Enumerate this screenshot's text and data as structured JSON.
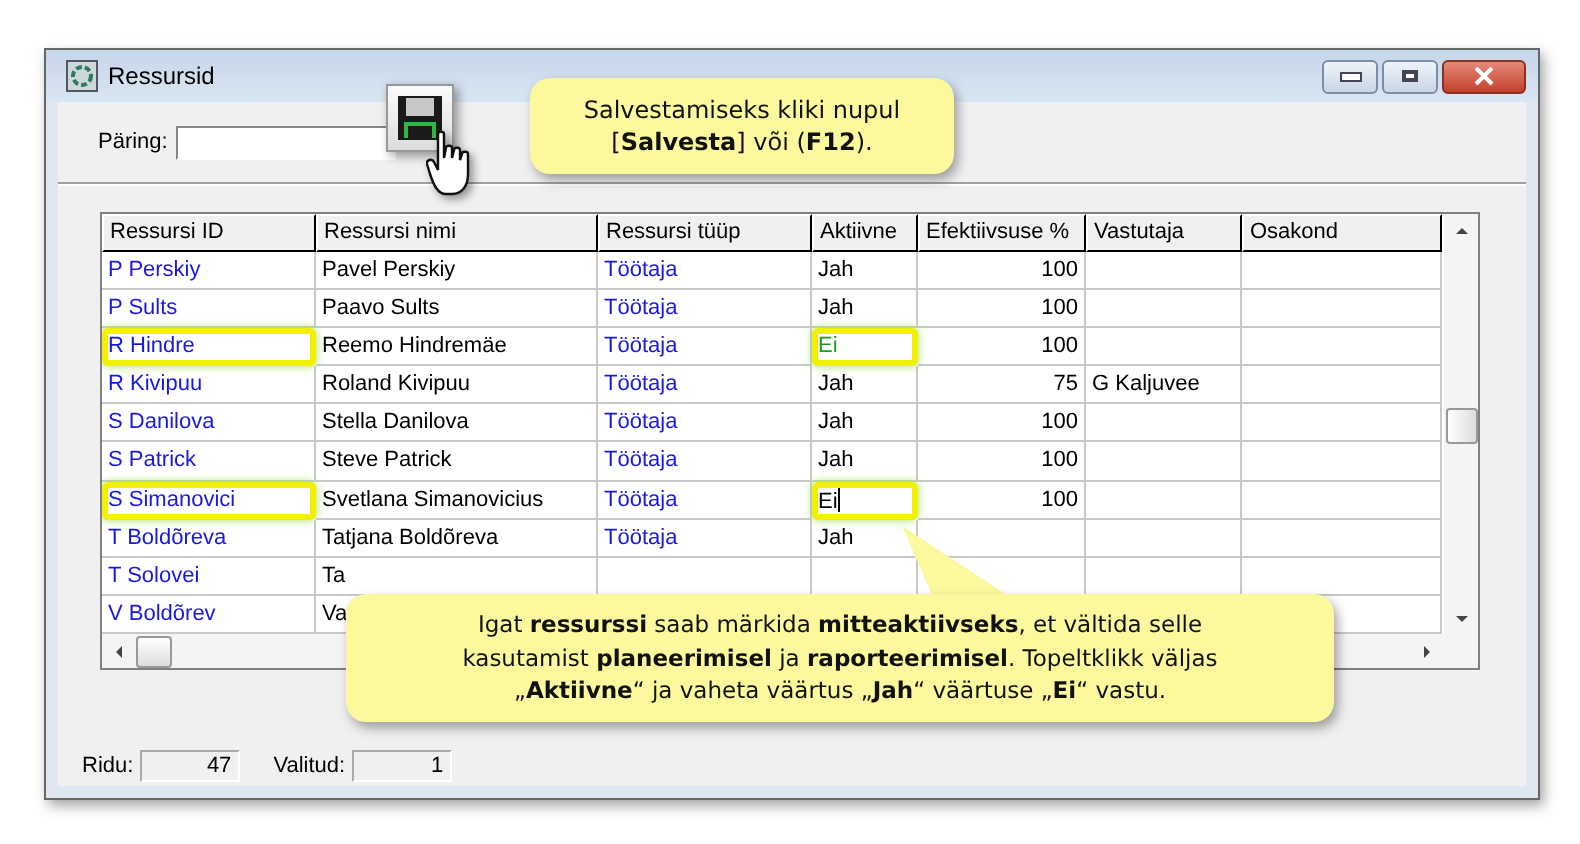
{
  "window": {
    "title": "Ressursid"
  },
  "query": {
    "label": "Päring:"
  },
  "table": {
    "columns": [
      "Ressursi ID",
      "Ressursi nimi",
      "Ressursi tüüp",
      "Aktiivne",
      "Efektiivsuse %",
      "Vastutaja",
      "Osakond"
    ],
    "rows": [
      {
        "id": "P Perskiy",
        "name": "Pavel Perskiy",
        "type": "Töötaja",
        "active": "Jah",
        "efficiency": "100",
        "highlighted": false,
        "changed": false,
        "editing": false
      },
      {
        "id": "P Sults",
        "name": "Paavo Sults",
        "type": "Töötaja",
        "active": "Jah",
        "efficiency": "100",
        "highlighted": false,
        "changed": false,
        "editing": false
      },
      {
        "id": "R Hindre",
        "name": "Reemo Hindremäe",
        "type": "Töötaja",
        "active": "Ei",
        "efficiency": "100",
        "highlighted": true,
        "changed": true,
        "editing": false
      },
      {
        "id": "R Kivipuu",
        "name": "Roland Kivipuu",
        "type": "Töötaja",
        "active": "Jah",
        "efficiency": "75",
        "manager": "G Kaljuvee",
        "highlighted": false,
        "changed": false,
        "editing": false
      },
      {
        "id": "S Danilova",
        "name": "Stella Danilova",
        "type": "Töötaja",
        "active": "Jah",
        "efficiency": "100",
        "highlighted": false,
        "changed": false,
        "editing": false
      },
      {
        "id": "S Patrick",
        "name": "Steve Patrick",
        "type": "Töötaja",
        "active": "Jah",
        "efficiency": "100",
        "highlighted": false,
        "changed": false,
        "editing": false
      },
      {
        "id": "S Simanovici",
        "name": "Svetlana Simanovicius",
        "type": "Töötaja",
        "active": "Ei",
        "efficiency": "100",
        "highlighted": true,
        "changed": false,
        "editing": true
      },
      {
        "id": "T Boldõreva",
        "name": "Tatjana Boldõreva",
        "type": "Töötaja",
        "active": "Jah",
        "highlighted": false,
        "changed": false,
        "editing": false
      },
      {
        "id": "T Solovei",
        "name": "Ta"
      },
      {
        "id": "V Boldõrev",
        "name": "Va"
      }
    ]
  },
  "status_bar": {
    "rows_label": "Ridu:",
    "rows_value": "47",
    "selected_label": "Valitud:",
    "selected_value": "1"
  },
  "callouts": [
    {
      "text": "Salvestamiseks kliki nupul [**Salvesta**] või (**F12**)."
    },
    {
      "text": "Igat **ressurssi** saab märkida **mitteaktiivseks**, et vältida selle kasutamist **planeerimisel** ja **raporteerimisel**. Topeltklikk väljas „**Aktiivne**“ ja vaheta väärtus „**Jah**“ väärtuse „**Ei**“ vastu."
    }
  ]
}
